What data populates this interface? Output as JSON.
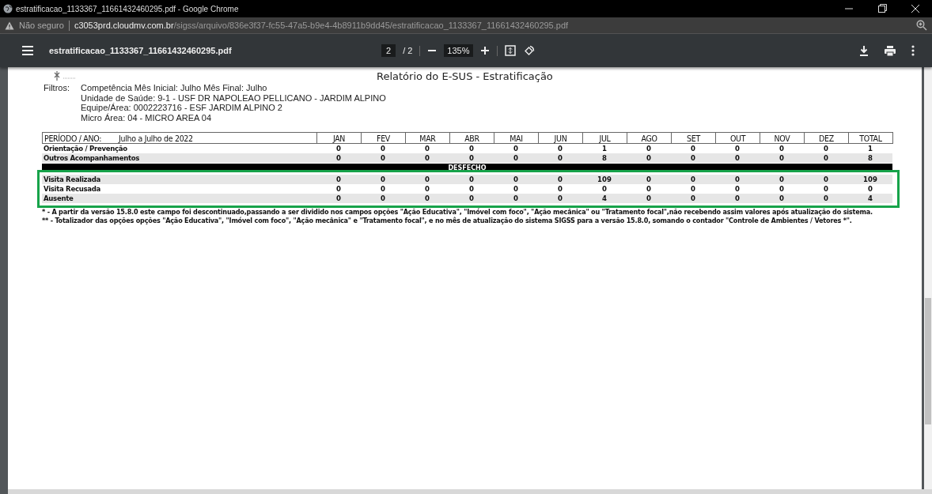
{
  "window": {
    "title": "estratificacao_1133367_11661432460295.pdf - Google Chrome"
  },
  "address_bar": {
    "security": "Não seguro",
    "host": "c3053prd.cloudmv.com.br",
    "path": "/sigss/arquivo/836e3f37-fc55-47a5-b9e4-4b8911b9dd45/estratificacao_1133367_11661432460295.pdf"
  },
  "pdf_toolbar": {
    "file_name": "estratificacao_1133367_11661432460295.pdf",
    "page": "2",
    "page_total": "/ 2",
    "zoom": "135%"
  },
  "report": {
    "heading": "Relatório do E-SUS - Estratificação",
    "filters_label": "Filtros:",
    "filters": [
      "Competência Mês Inicial: Julho Mês Final: Julho",
      "Unidade de Saúde: 9-1  -  USF DR NAPOLEAO PELLICANO - JARDIM ALPINO",
      "Equipe/Área: 0002223716  -  ESF JARDIM ALPINO 2",
      "Micro Área: 04  -  MICRO AREA 04"
    ],
    "table": {
      "period_label": "PERÍODO / ANO:",
      "period": "Julho a Julho de 2022",
      "columns": [
        "JAN",
        "FEV",
        "MAR",
        "ABR",
        "MAI",
        "JUN",
        "JUL",
        "AGO",
        "SET",
        "OUT",
        "NOV",
        "DEZ",
        "TOTAL"
      ],
      "sections": [
        {
          "highlighted": false,
          "rows": [
            {
              "label": "Orientação / Prevenção",
              "shaded": false,
              "values": [
                "0",
                "0",
                "0",
                "0",
                "0",
                "0",
                "1",
                "0",
                "0",
                "0",
                "0",
                "0",
                "1"
              ]
            },
            {
              "label": "Outros Acompanhamentos",
              "shaded": true,
              "values": [
                "0",
                "0",
                "0",
                "0",
                "0",
                "0",
                "8",
                "0",
                "0",
                "0",
                "0",
                "0",
                "8"
              ]
            }
          ]
        },
        {
          "title": "DESFECHO",
          "highlighted": true,
          "rows": [
            {
              "label": "Visita Realizada",
              "shaded": true,
              "values": [
                "0",
                "0",
                "0",
                "0",
                "0",
                "0",
                "109",
                "0",
                "0",
                "0",
                "0",
                "0",
                "109"
              ]
            },
            {
              "label": "Visita Recusada",
              "shaded": false,
              "values": [
                "0",
                "0",
                "0",
                "0",
                "0",
                "0",
                "0",
                "0",
                "0",
                "0",
                "0",
                "0",
                "0"
              ]
            },
            {
              "label": "Ausente",
              "shaded": true,
              "values": [
                "0",
                "0",
                "0",
                "0",
                "0",
                "0",
                "4",
                "0",
                "0",
                "0",
                "0",
                "0",
                "4"
              ]
            }
          ]
        }
      ]
    },
    "footnotes": [
      "* - A partir da versão 15.8.0 este campo foi descontinuado,passando a ser dividido nos campos opções \"Ação Educativa\", \"Imóvel com foco\", \"Ação mecânica\" ou \"Tratamento focal\",não recebendo assim valores após atualização do sistema.",
      "** -  Totalizador das opções opções \"Ação Educativa\", \"Imóvel com foco\", \"Ação mecânica\" e \"Tratamento focal\", e no mês de atualização do sistema SIGSS para a versão 15.8.0, somando o contador \"Controle de Ambientes / Vetores *\"."
    ]
  }
}
